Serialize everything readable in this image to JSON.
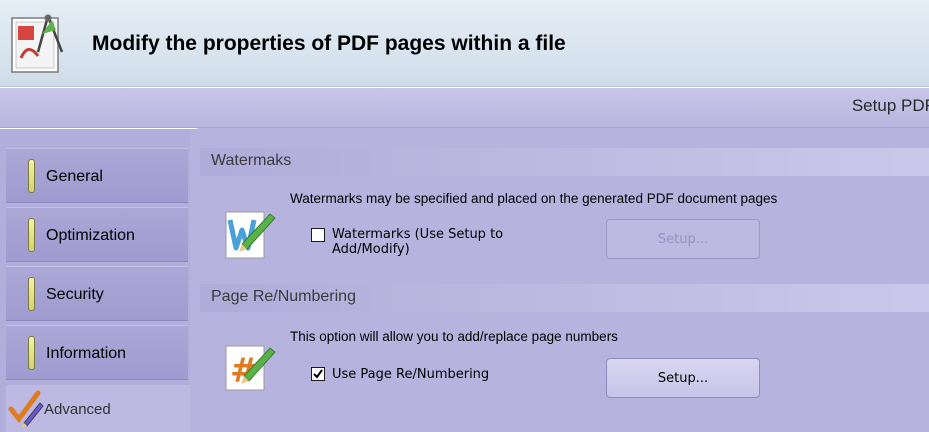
{
  "window": {
    "title": "Modify the properties of PDF pages within a file"
  },
  "toolbar": {
    "setup_label": "Setup PDF"
  },
  "sidebar": {
    "items": [
      {
        "label": "General"
      },
      {
        "label": "Optimization"
      },
      {
        "label": "Security"
      },
      {
        "label": "Information"
      },
      {
        "label": "Advanced"
      }
    ],
    "active": "Advanced"
  },
  "watermarks": {
    "header": "Watermaks",
    "description": "Watermarks may be specified and placed on the generated PDF document pages",
    "checkbox_label": "Watermarks (Use Setup to Add/Modify)",
    "checked": false,
    "setup_button": "Setup...",
    "setup_enabled": false,
    "icon": "watermark-icon"
  },
  "renumbering": {
    "header": "Page Re/Numbering",
    "description": "This option will allow you to add/replace page numbers",
    "checkbox_label": "Use Page Re/Numbering",
    "checked": true,
    "setup_button": "Setup...",
    "setup_enabled": true,
    "icon": "page-number-icon"
  },
  "colors": {
    "panel": "#b7b3df",
    "title_bar": "#dfe8f2",
    "tab_marker": "#e8e68a"
  }
}
